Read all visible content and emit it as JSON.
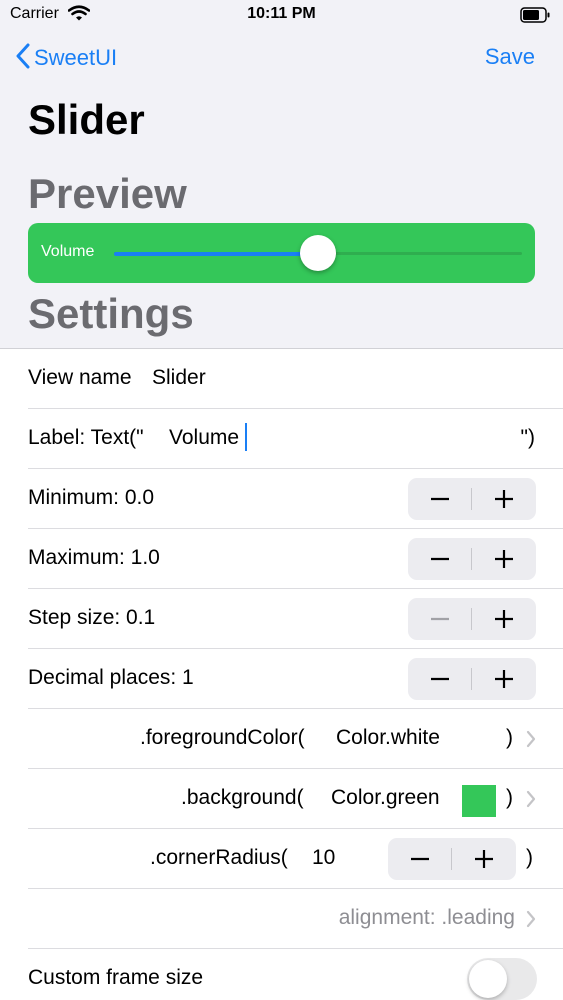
{
  "status_bar": {
    "carrier": "Carrier",
    "time": "10:11 PM"
  },
  "nav": {
    "back_label": "SweetUI",
    "save_label": "Save"
  },
  "page_title": "Slider",
  "preview": {
    "section_title": "Preview",
    "label": "Volume",
    "slider_value": 0.5,
    "background_color": "#34c759",
    "tint_color": "#1a7ff5"
  },
  "settings": {
    "section_title": "Settings",
    "view_name": {
      "label": "View name",
      "value": "Slider"
    },
    "label_field": {
      "prefix": "Label: Text(\"",
      "value": "Volume",
      "suffix": "\")"
    },
    "minimum": {
      "label": "Minimum: 0.0"
    },
    "maximum": {
      "label": "Maximum: 1.0"
    },
    "step_size": {
      "label": "Step size: 0.1"
    },
    "decimal_places": {
      "label": "Decimal places: 1"
    },
    "foreground_color": {
      "prefix": ".foregroundColor(",
      "value": "Color.white",
      "suffix": ")"
    },
    "background": {
      "prefix": ".background(",
      "value": "Color.green",
      "suffix": ")",
      "swatch_color": "#34c759"
    },
    "corner_radius": {
      "prefix": ".cornerRadius(",
      "value": "10",
      "suffix": ")"
    },
    "alignment": {
      "label": "alignment: .leading"
    },
    "custom_frame": {
      "label": "Custom frame size",
      "enabled": false
    }
  }
}
